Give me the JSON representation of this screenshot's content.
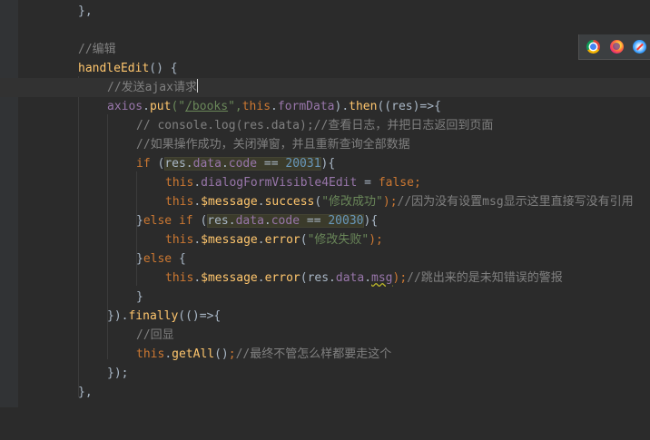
{
  "editor": {
    "lines": {
      "l1": {
        "close": "},"
      },
      "l3": {
        "comment": "//编辑"
      },
      "l4": {
        "method": "handleEdit",
        "rest": "() {"
      },
      "l5": {
        "comment": "//发送ajax请求"
      },
      "l6": {
        "obj": "axios",
        "dot1": ".",
        "put": "put",
        "open": "(\"",
        "url": "/books",
        "comma": "\",",
        "this": "this",
        "dot2": ".",
        "formData": "formData",
        "close": ").",
        "then": "then",
        "args": "((res)=>{"
      },
      "l7": {
        "comment": "// console.log(res.data);//查看日志，并把日志返回到页面"
      },
      "l8": {
        "comment": "//如果操作成功，关闭弹窗，并且重新查询全部数据"
      },
      "l9": {
        "if": "if",
        "open": " (",
        "res": "res",
        "dot1": ".",
        "data": "data",
        "dot2": ".",
        "code": "code",
        "eq": " == ",
        "num": "20031",
        "close": "){"
      },
      "l10": {
        "this": "this",
        "dot": ".",
        "prop": "dialogFormVisible4Edit",
        "eq": " = ",
        "val": "false",
        "semi": ";"
      },
      "l11": {
        "this": "this",
        "dot1": ".",
        "message": "$message",
        "dot2": ".",
        "fn": "success",
        "open": "(",
        "str": "\"修改成功\"",
        "close": ");",
        "comment": "//因为没有设置msg显示这里直接写没有引用"
      },
      "l12": {
        "brace": "}",
        "else": "else if",
        "open": " (",
        "res": "res",
        "dot1": ".",
        "data": "data",
        "dot2": ".",
        "code": "code",
        "eq": " == ",
        "num": "20030",
        "close": "){"
      },
      "l13": {
        "this": "this",
        "dot1": ".",
        "message": "$message",
        "dot2": ".",
        "fn": "error",
        "open": "(",
        "str": "\"修改失败\"",
        "close": ");"
      },
      "l14": {
        "brace": "}",
        "else": "else",
        "rest": " {"
      },
      "l15": {
        "this": "this",
        "dot1": ".",
        "message": "$message",
        "dot2": ".",
        "fn": "error",
        "open": "(",
        "res": "res",
        "dot3": ".",
        "data": "data",
        "dot4": ".",
        "msg": "msg",
        "close": ");",
        "comment": "//跳出来的是未知错误的警报"
      },
      "l16": {
        "close": "}"
      },
      "l17": {
        "open": "}).",
        "finally": "finally",
        "rest": "(()=>{"
      },
      "l18": {
        "comment": "//回显"
      },
      "l19": {
        "this": "this",
        "dot": ".",
        "fn": "getAll",
        "call": "()",
        "semi": ";",
        "comment": "//最终不管怎么样都要走这个"
      },
      "l20": {
        "close": "});"
      },
      "l21": {
        "close": "},"
      }
    }
  },
  "browser_bar": {
    "icons": [
      "chrome-icon",
      "firefox-icon",
      "safari-icon"
    ]
  }
}
